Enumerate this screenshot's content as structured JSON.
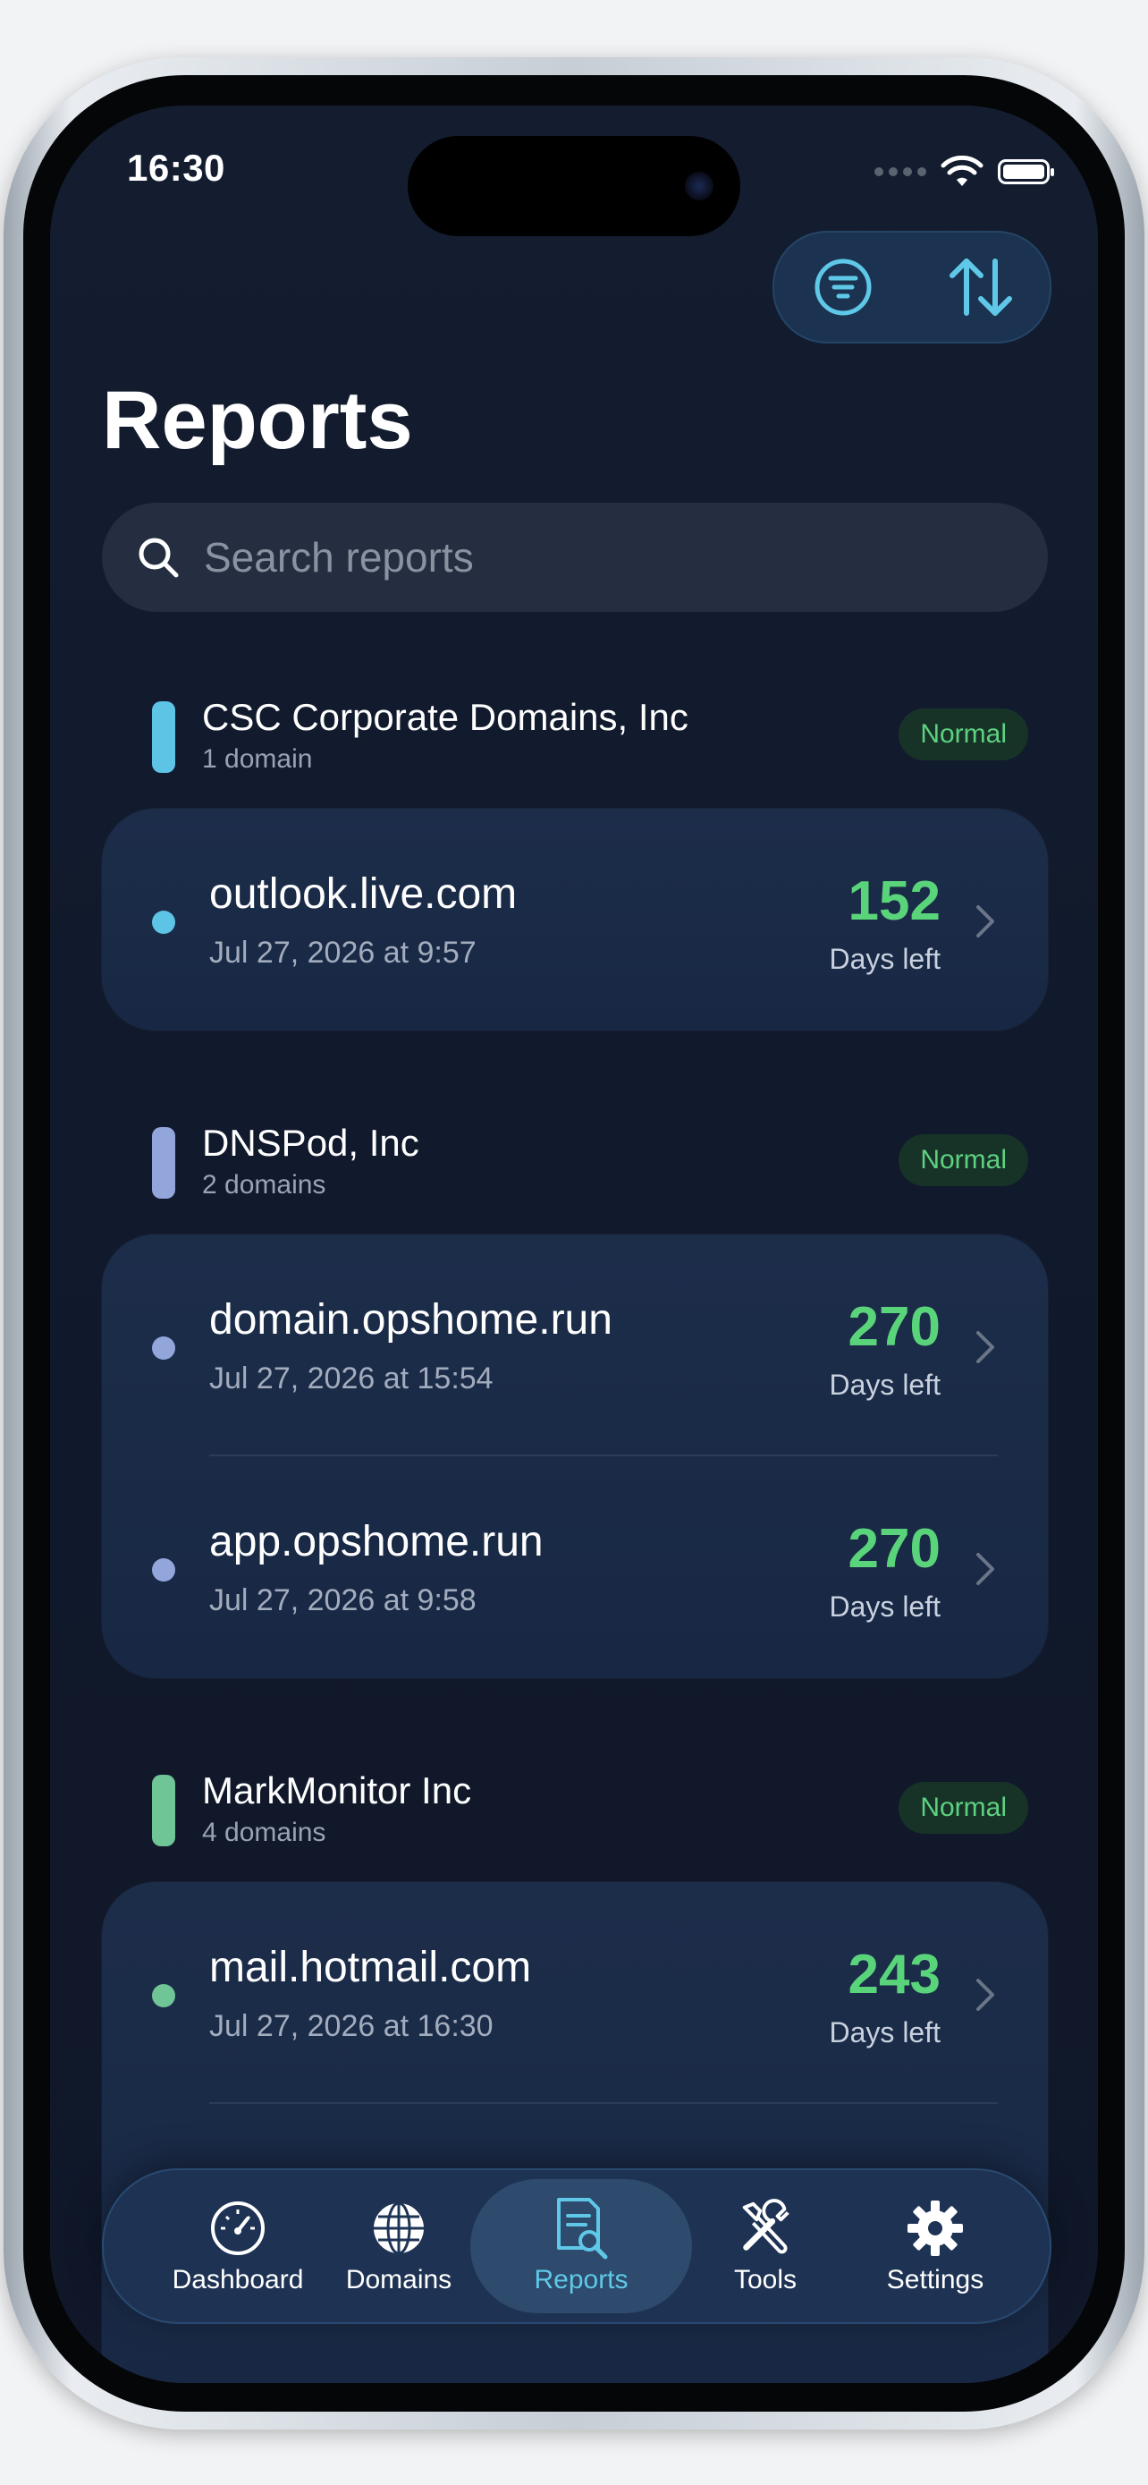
{
  "status_bar": {
    "time": "16:30"
  },
  "header": {
    "title": "Reports"
  },
  "search": {
    "placeholder": "Search reports"
  },
  "groups": [
    {
      "name": "CSC Corporate Domains, Inc",
      "count": "1 domain",
      "status": "Normal",
      "color": "#5ec4e6",
      "rows": [
        {
          "domain": "outlook.live.com",
          "date": "Jul 27, 2026 at 9:57",
          "days": "152",
          "days_label": "Days left"
        }
      ]
    },
    {
      "name": "DNSPod, Inc",
      "count": "2 domains",
      "status": "Normal",
      "color": "#93a6dc",
      "rows": [
        {
          "domain": "domain.opshome.run",
          "date": "Jul 27, 2026 at 15:54",
          "days": "270",
          "days_label": "Days left"
        },
        {
          "domain": "app.opshome.run",
          "date": "Jul 27, 2026 at 9:58",
          "days": "270",
          "days_label": "Days left"
        }
      ]
    },
    {
      "name": "MarkMonitor Inc",
      "count": "4 domains",
      "status": "Normal",
      "color": "#6fc596",
      "rows": [
        {
          "domain": "mail.hotmail.com",
          "date": "Jul 27, 2026 at 16:30",
          "days": "243",
          "days_label": "Days left"
        }
      ]
    }
  ],
  "tab_bar": {
    "items": [
      {
        "label": "Dashboard",
        "icon": "gauge-icon"
      },
      {
        "label": "Domains",
        "icon": "globe-icon"
      },
      {
        "label": "Reports",
        "icon": "report-icon",
        "active": true
      },
      {
        "label": "Tools",
        "icon": "tools-icon"
      },
      {
        "label": "Settings",
        "icon": "gear-icon"
      }
    ]
  },
  "colors": {
    "accent": "#5fc8e8",
    "days_green": "#5ad47a",
    "badge_bg": "#173328",
    "badge_text": "#5ed180"
  }
}
